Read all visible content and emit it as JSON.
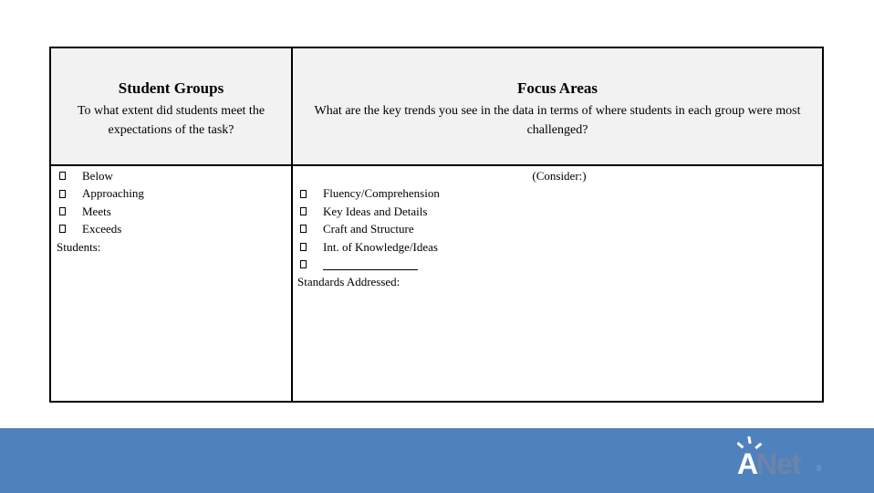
{
  "table": {
    "student_groups": {
      "title": "Student Groups",
      "subtitle": "To what extent did students meet the expectations of the task?",
      "options": [
        "Below",
        "Approaching",
        "Meets",
        "Exceeds"
      ],
      "students_label": "Students:"
    },
    "focus_areas": {
      "title": "Focus Areas",
      "subtitle": "What are the key trends you see in the data in terms of where students in each group were most challenged?",
      "consider_label": "(Consider:)",
      "options": [
        "Fluency/Comprehension",
        "Key Ideas and Details",
        "Craft and Structure",
        "Int. of Knowledge/Ideas"
      ],
      "standards_label": "Standards Addressed:"
    }
  },
  "footer": {
    "logo_a": "A",
    "logo_net": "Net",
    "slide_number": "9",
    "band_color": "#4f81bd"
  }
}
